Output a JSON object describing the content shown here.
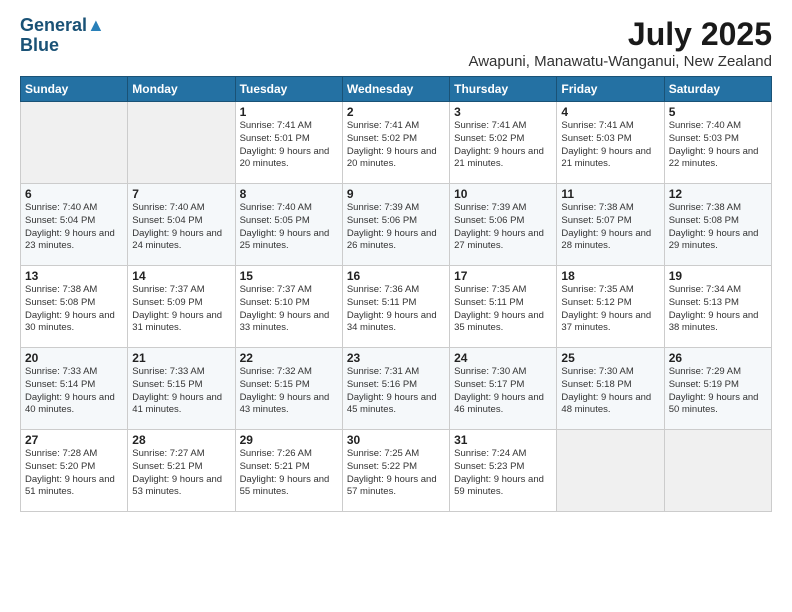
{
  "logo": {
    "line1": "General",
    "line2": "Blue"
  },
  "title": "July 2025",
  "location": "Awapuni, Manawatu-Wanganui, New Zealand",
  "days_of_week": [
    "Sunday",
    "Monday",
    "Tuesday",
    "Wednesday",
    "Thursday",
    "Friday",
    "Saturday"
  ],
  "weeks": [
    [
      {
        "day": "",
        "sunrise": "",
        "sunset": "",
        "daylight": ""
      },
      {
        "day": "",
        "sunrise": "",
        "sunset": "",
        "daylight": ""
      },
      {
        "day": "1",
        "sunrise": "Sunrise: 7:41 AM",
        "sunset": "Sunset: 5:01 PM",
        "daylight": "Daylight: 9 hours and 20 minutes."
      },
      {
        "day": "2",
        "sunrise": "Sunrise: 7:41 AM",
        "sunset": "Sunset: 5:02 PM",
        "daylight": "Daylight: 9 hours and 20 minutes."
      },
      {
        "day": "3",
        "sunrise": "Sunrise: 7:41 AM",
        "sunset": "Sunset: 5:02 PM",
        "daylight": "Daylight: 9 hours and 21 minutes."
      },
      {
        "day": "4",
        "sunrise": "Sunrise: 7:41 AM",
        "sunset": "Sunset: 5:03 PM",
        "daylight": "Daylight: 9 hours and 21 minutes."
      },
      {
        "day": "5",
        "sunrise": "Sunrise: 7:40 AM",
        "sunset": "Sunset: 5:03 PM",
        "daylight": "Daylight: 9 hours and 22 minutes."
      }
    ],
    [
      {
        "day": "6",
        "sunrise": "Sunrise: 7:40 AM",
        "sunset": "Sunset: 5:04 PM",
        "daylight": "Daylight: 9 hours and 23 minutes."
      },
      {
        "day": "7",
        "sunrise": "Sunrise: 7:40 AM",
        "sunset": "Sunset: 5:04 PM",
        "daylight": "Daylight: 9 hours and 24 minutes."
      },
      {
        "day": "8",
        "sunrise": "Sunrise: 7:40 AM",
        "sunset": "Sunset: 5:05 PM",
        "daylight": "Daylight: 9 hours and 25 minutes."
      },
      {
        "day": "9",
        "sunrise": "Sunrise: 7:39 AM",
        "sunset": "Sunset: 5:06 PM",
        "daylight": "Daylight: 9 hours and 26 minutes."
      },
      {
        "day": "10",
        "sunrise": "Sunrise: 7:39 AM",
        "sunset": "Sunset: 5:06 PM",
        "daylight": "Daylight: 9 hours and 27 minutes."
      },
      {
        "day": "11",
        "sunrise": "Sunrise: 7:38 AM",
        "sunset": "Sunset: 5:07 PM",
        "daylight": "Daylight: 9 hours and 28 minutes."
      },
      {
        "day": "12",
        "sunrise": "Sunrise: 7:38 AM",
        "sunset": "Sunset: 5:08 PM",
        "daylight": "Daylight: 9 hours and 29 minutes."
      }
    ],
    [
      {
        "day": "13",
        "sunrise": "Sunrise: 7:38 AM",
        "sunset": "Sunset: 5:08 PM",
        "daylight": "Daylight: 9 hours and 30 minutes."
      },
      {
        "day": "14",
        "sunrise": "Sunrise: 7:37 AM",
        "sunset": "Sunset: 5:09 PM",
        "daylight": "Daylight: 9 hours and 31 minutes."
      },
      {
        "day": "15",
        "sunrise": "Sunrise: 7:37 AM",
        "sunset": "Sunset: 5:10 PM",
        "daylight": "Daylight: 9 hours and 33 minutes."
      },
      {
        "day": "16",
        "sunrise": "Sunrise: 7:36 AM",
        "sunset": "Sunset: 5:11 PM",
        "daylight": "Daylight: 9 hours and 34 minutes."
      },
      {
        "day": "17",
        "sunrise": "Sunrise: 7:35 AM",
        "sunset": "Sunset: 5:11 PM",
        "daylight": "Daylight: 9 hours and 35 minutes."
      },
      {
        "day": "18",
        "sunrise": "Sunrise: 7:35 AM",
        "sunset": "Sunset: 5:12 PM",
        "daylight": "Daylight: 9 hours and 37 minutes."
      },
      {
        "day": "19",
        "sunrise": "Sunrise: 7:34 AM",
        "sunset": "Sunset: 5:13 PM",
        "daylight": "Daylight: 9 hours and 38 minutes."
      }
    ],
    [
      {
        "day": "20",
        "sunrise": "Sunrise: 7:33 AM",
        "sunset": "Sunset: 5:14 PM",
        "daylight": "Daylight: 9 hours and 40 minutes."
      },
      {
        "day": "21",
        "sunrise": "Sunrise: 7:33 AM",
        "sunset": "Sunset: 5:15 PM",
        "daylight": "Daylight: 9 hours and 41 minutes."
      },
      {
        "day": "22",
        "sunrise": "Sunrise: 7:32 AM",
        "sunset": "Sunset: 5:15 PM",
        "daylight": "Daylight: 9 hours and 43 minutes."
      },
      {
        "day": "23",
        "sunrise": "Sunrise: 7:31 AM",
        "sunset": "Sunset: 5:16 PM",
        "daylight": "Daylight: 9 hours and 45 minutes."
      },
      {
        "day": "24",
        "sunrise": "Sunrise: 7:30 AM",
        "sunset": "Sunset: 5:17 PM",
        "daylight": "Daylight: 9 hours and 46 minutes."
      },
      {
        "day": "25",
        "sunrise": "Sunrise: 7:30 AM",
        "sunset": "Sunset: 5:18 PM",
        "daylight": "Daylight: 9 hours and 48 minutes."
      },
      {
        "day": "26",
        "sunrise": "Sunrise: 7:29 AM",
        "sunset": "Sunset: 5:19 PM",
        "daylight": "Daylight: 9 hours and 50 minutes."
      }
    ],
    [
      {
        "day": "27",
        "sunrise": "Sunrise: 7:28 AM",
        "sunset": "Sunset: 5:20 PM",
        "daylight": "Daylight: 9 hours and 51 minutes."
      },
      {
        "day": "28",
        "sunrise": "Sunrise: 7:27 AM",
        "sunset": "Sunset: 5:21 PM",
        "daylight": "Daylight: 9 hours and 53 minutes."
      },
      {
        "day": "29",
        "sunrise": "Sunrise: 7:26 AM",
        "sunset": "Sunset: 5:21 PM",
        "daylight": "Daylight: 9 hours and 55 minutes."
      },
      {
        "day": "30",
        "sunrise": "Sunrise: 7:25 AM",
        "sunset": "Sunset: 5:22 PM",
        "daylight": "Daylight: 9 hours and 57 minutes."
      },
      {
        "day": "31",
        "sunrise": "Sunrise: 7:24 AM",
        "sunset": "Sunset: 5:23 PM",
        "daylight": "Daylight: 9 hours and 59 minutes."
      },
      {
        "day": "",
        "sunrise": "",
        "sunset": "",
        "daylight": ""
      },
      {
        "day": "",
        "sunrise": "",
        "sunset": "",
        "daylight": ""
      }
    ]
  ]
}
